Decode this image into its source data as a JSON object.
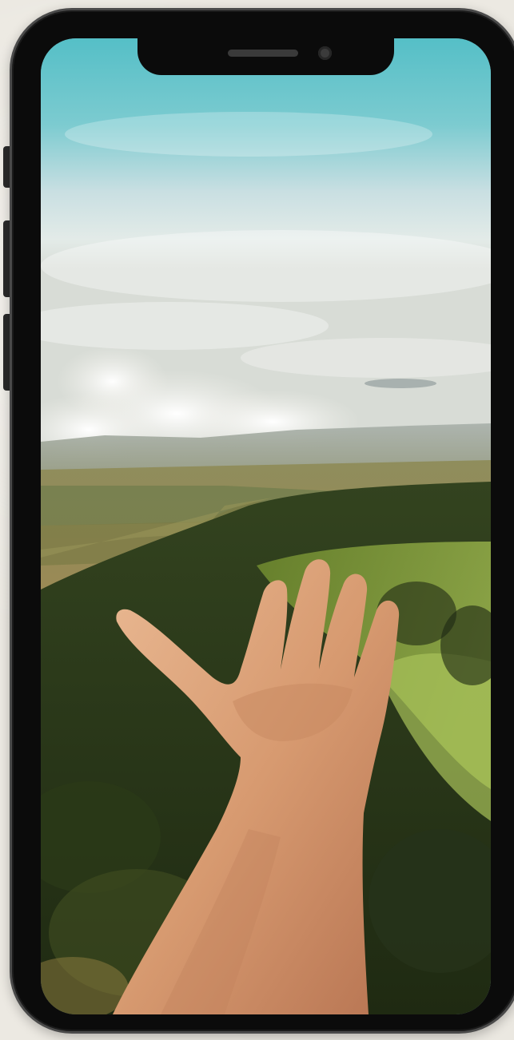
{
  "device": {
    "frame_color": "#0b0b0b",
    "bezel_color": "#4a4a4a",
    "background_color": "#ece9e2"
  },
  "screen": {
    "image_description_icon": "photo-image",
    "sky_top_color": "#5fc2c9",
    "sky_mid_color": "#cfe3e8",
    "cloud_color": "#f4f3ef",
    "hills_far_color": "#8e9b86",
    "hills_near_color": "#2f3d1e",
    "grass_color": "#7f9b3d",
    "skin_color": "#d9a07a"
  }
}
